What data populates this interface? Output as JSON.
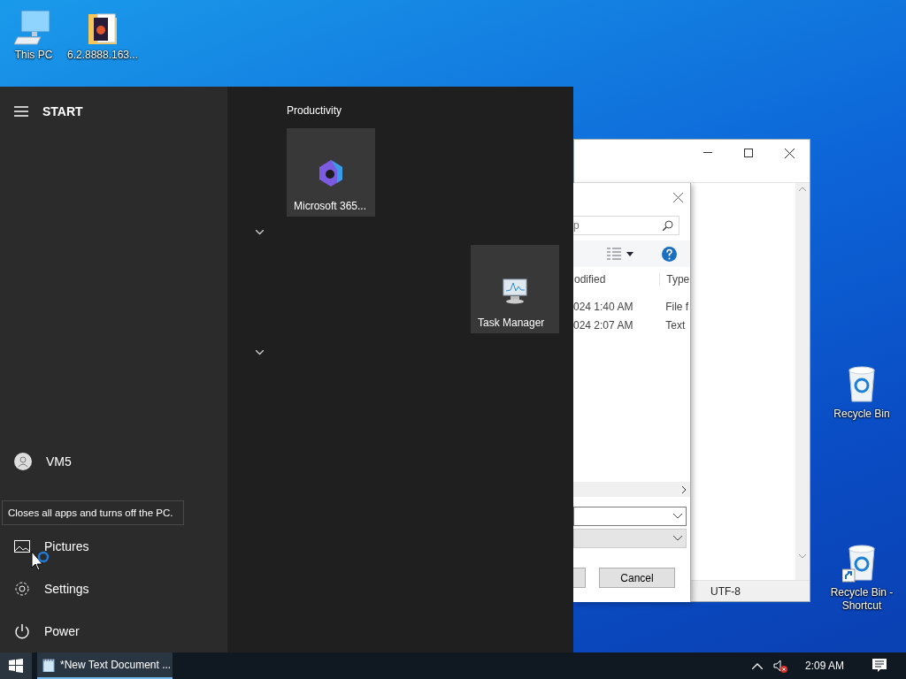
{
  "desktop_icons": [
    {
      "label": "This PC",
      "kind": "computer"
    },
    {
      "label": "6.2.8888.163...",
      "kind": "folder"
    },
    {
      "label": "Recycle Bin",
      "kind": "recycle"
    },
    {
      "label": "Recycle Bin - Shortcut",
      "kind": "recycle-shortcut"
    }
  ],
  "notepad": {
    "encoding": "UTF-8"
  },
  "dialog": {
    "search_value": "p",
    "columns": [
      "odified",
      "Type"
    ],
    "rows": [
      {
        "modified": "024 1:40 AM",
        "type": "File f"
      },
      {
        "modified": "024 2:07 AM",
        "type": "Text"
      }
    ],
    "cancel": "Cancel"
  },
  "start_menu": {
    "title": "START",
    "items": [
      {
        "kind": "user",
        "label": "VM5"
      },
      {
        "kind": "tooltip",
        "label": "Closes all apps and turns off the PC."
      },
      {
        "kind": "pictures",
        "label": "Pictures"
      },
      {
        "kind": "settings",
        "label": "Settings"
      },
      {
        "kind": "power",
        "label": "Power"
      }
    ],
    "group_title": "Productivity",
    "tiles": [
      {
        "kind": "m365",
        "label": "Microsoft 365..."
      },
      {
        "kind": "taskmgr",
        "label": "Task Manager"
      }
    ]
  },
  "taskbar": {
    "start_open": true,
    "tasks": [
      {
        "label": "*New Text Document ...",
        "selected": true
      }
    ],
    "volume_muted": true,
    "clock": "2:09 AM"
  }
}
